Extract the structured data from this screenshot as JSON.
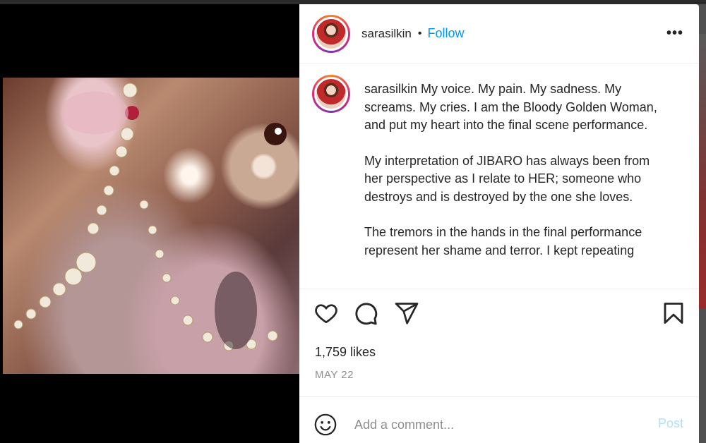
{
  "post": {
    "username": "sarasilkin",
    "follow_label": "Follow",
    "more_label": "•••",
    "caption_paragraphs": [
      "My voice. My pain. My sadness. My screams. My cries. I am the Bloody Golden Woman, and put my heart into the final scene performance.",
      "My interpretation of JIBARO has always been from her perspective as I relate to HER; someone who destroys and is destroyed by the one she loves.",
      "The tremors in the hands in the final performance represent her shame and terror. I kept repeating"
    ],
    "likes": "1,759 likes",
    "date": "MAY 22"
  },
  "actions": {
    "like_icon": "heart-icon",
    "comment_icon": "comment-icon",
    "share_icon": "paper-plane-icon",
    "save_icon": "bookmark-icon"
  },
  "comment": {
    "placeholder": "Add a comment...",
    "post_label": "Post",
    "emoji_icon": "smiley-icon"
  },
  "colors": {
    "accent": "#0095f6",
    "post_disabled": "#b2dffc",
    "muted": "#8e8e8e"
  }
}
